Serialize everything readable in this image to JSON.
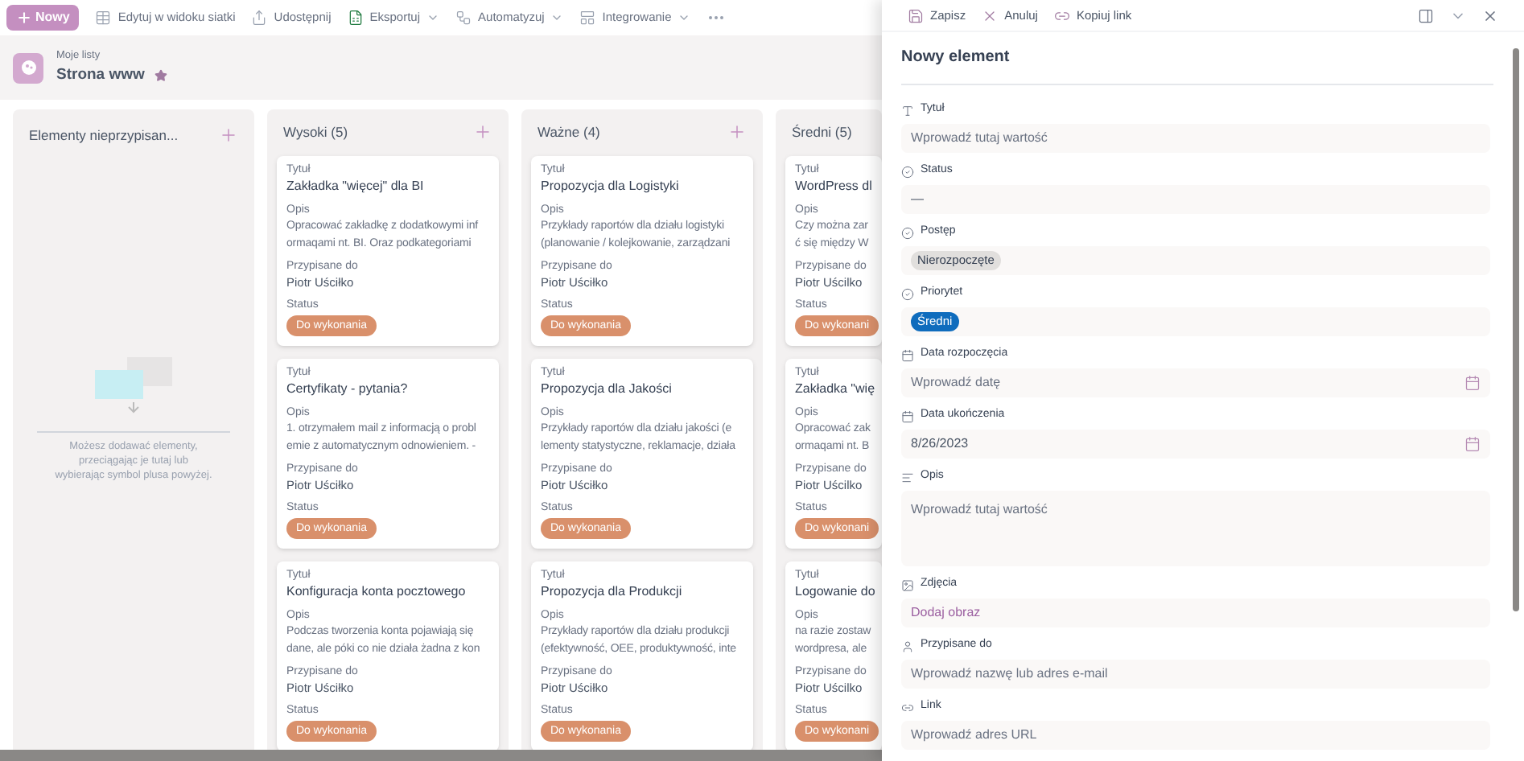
{
  "toolbar": {
    "new_button": "Nowy",
    "items": [
      {
        "kind": "grid",
        "label": "Edytuj w widoku siatki",
        "has_menu": false
      },
      {
        "kind": "share",
        "label": "Udostępnij",
        "has_menu": false
      },
      {
        "kind": "excel",
        "label": "Eksportuj",
        "has_menu": true
      },
      {
        "kind": "automate",
        "label": "Automatyzuj",
        "has_menu": true
      },
      {
        "kind": "integrate",
        "label": "Integrowanie",
        "has_menu": true
      }
    ]
  },
  "header": {
    "breadcrumb": "Moje listy",
    "title": "Strona www",
    "favorite": true
  },
  "board": {
    "columns": [
      {
        "title": "Elementy nieprzypisan...",
        "empty_hint": "Możesz dodawać elementy, przeciągając je tutaj lub wybierając symbol plusa powyżej."
      },
      {
        "title": "Wysoki (5)",
        "cards": [
          {
            "title_label": "Tytuł",
            "title": "Zakładka \"więcej\" dla BI",
            "desc_label": "Opis",
            "desc_lines": [
              "Opracować zakładkę z dodatkowymi inf",
              "ormaqami nt. BI. Oraz podkategoriami"
            ],
            "assignee_label": "Przypisane do",
            "assignee": "Piotr Uściłko",
            "status_label": "Status",
            "status": "Do wykonania"
          },
          {
            "title_label": "Tytuł",
            "title": "Certyfikaty - pytania?",
            "desc_label": "Opis",
            "desc_lines": [
              "1. otrzymałem mail z informacją o probl",
              "emie z automatycznym odnowieniem. -"
            ],
            "assignee_label": "Przypisane do",
            "assignee": "Piotr Uściłko",
            "status_label": "Status",
            "status": "Do wykonania"
          },
          {
            "title_label": "Tytuł",
            "title": "Konfiguracja konta pocztowego",
            "desc_label": "Opis",
            "desc_lines": [
              "Podczas tworzenia konta pojawiają się",
              "dane, ale póki co nie działa żadna z kon"
            ],
            "assignee_label": "Przypisane do",
            "assignee": "Piotr Uściłko",
            "status_label": "Status",
            "status": "Do wykonania"
          }
        ]
      },
      {
        "title": "Ważne (4)",
        "cards": [
          {
            "title_label": "Tytuł",
            "title": "Propozycja dla Logistyki",
            "desc_label": "Opis",
            "desc_lines": [
              "Przykłady raportów dla działu logistyki",
              "(planowanie / kolejkowanie, zarządzani"
            ],
            "assignee_label": "Przypisane do",
            "assignee": "Piotr Uściłko",
            "status_label": "Status",
            "status": "Do wykonania"
          },
          {
            "title_label": "Tytuł",
            "title": "Propozycja dla Jakości",
            "desc_label": "Opis",
            "desc_lines": [
              "Przykłady raportów dla działu jakości (e",
              "lementy statystyczne, reklamacje, działa"
            ],
            "assignee_label": "Przypisane do",
            "assignee": "Piotr Uściłko",
            "status_label": "Status",
            "status": "Do wykonania"
          },
          {
            "title_label": "Tytuł",
            "title": "Propozycja dla Produkcji",
            "desc_label": "Opis",
            "desc_lines": [
              "Przykłady raportów dla działu produkcji",
              "(efektywność, OEE, produktywność, inte"
            ],
            "assignee_label": "Przypisane do",
            "assignee": "Piotr Uściłko",
            "status_label": "Status",
            "status": "Do wykonania"
          }
        ]
      },
      {
        "title": "Średni (5)",
        "cut": true,
        "cards": [
          {
            "title_label": "Tytuł",
            "title": "WordPress dl",
            "desc_label": "Opis",
            "desc_lines": [
              "Czy można zar",
              "ć się między W"
            ],
            "assignee_label": "Przypisane do",
            "assignee": "Piotr Uścilko",
            "status_label": "Status",
            "status": "Do wykonani"
          },
          {
            "title_label": "Tytuł",
            "title": "Zakładka \"wię",
            "desc_label": "Opis",
            "desc_lines": [
              "Opracować zak",
              "ormaqami nt. B"
            ],
            "assignee_label": "Przypisane do",
            "assignee": "Piotr Uścilko",
            "status_label": "Status",
            "status": "Do wykonani"
          },
          {
            "title_label": "Tytuł",
            "title": "Logowanie do",
            "desc_label": "Opis",
            "desc_lines": [
              "na razie zostaw",
              "wordpresa, ale"
            ],
            "assignee_label": "Przypisane do",
            "assignee": "Piotr Uścilko",
            "status_label": "Status",
            "status": "Do wykonani"
          }
        ]
      }
    ]
  },
  "panel": {
    "actions": [
      {
        "kind": "save",
        "label": "Zapisz"
      },
      {
        "kind": "cancel",
        "label": "Anuluj"
      },
      {
        "kind": "link",
        "label": "Kopiuj link"
      }
    ],
    "title": "Nowy element",
    "fields": [
      {
        "kind": "text",
        "label": "Tytuł",
        "placeholder": "Wprowadź tutaj wartość"
      },
      {
        "kind": "choice",
        "label": "Status",
        "value": "—"
      },
      {
        "kind": "pill",
        "label": "Postęp",
        "value": "Nierozpoczęte",
        "color": "#e1dfdd"
      },
      {
        "kind": "pill",
        "label": "Priorytet",
        "value": "Średni",
        "color": "#0f6cbd"
      },
      {
        "kind": "date",
        "label": "Data rozpoczęcia",
        "placeholder": "Wprowadź datę"
      },
      {
        "kind": "date",
        "label": "Data ukończenia",
        "value": "8/26/2023"
      },
      {
        "kind": "textarea",
        "label": "Opis",
        "placeholder": "Wprowadź tutaj wartość"
      },
      {
        "kind": "image",
        "label": "Zdjęcia",
        "value": "Dodaj obraz"
      },
      {
        "kind": "text",
        "label": "Przypisane do",
        "placeholder": "Wprowadź nazwę lub adres e-mail"
      },
      {
        "kind": "text",
        "label": "Link",
        "placeholder": "Wprowadź adres URL"
      }
    ]
  }
}
